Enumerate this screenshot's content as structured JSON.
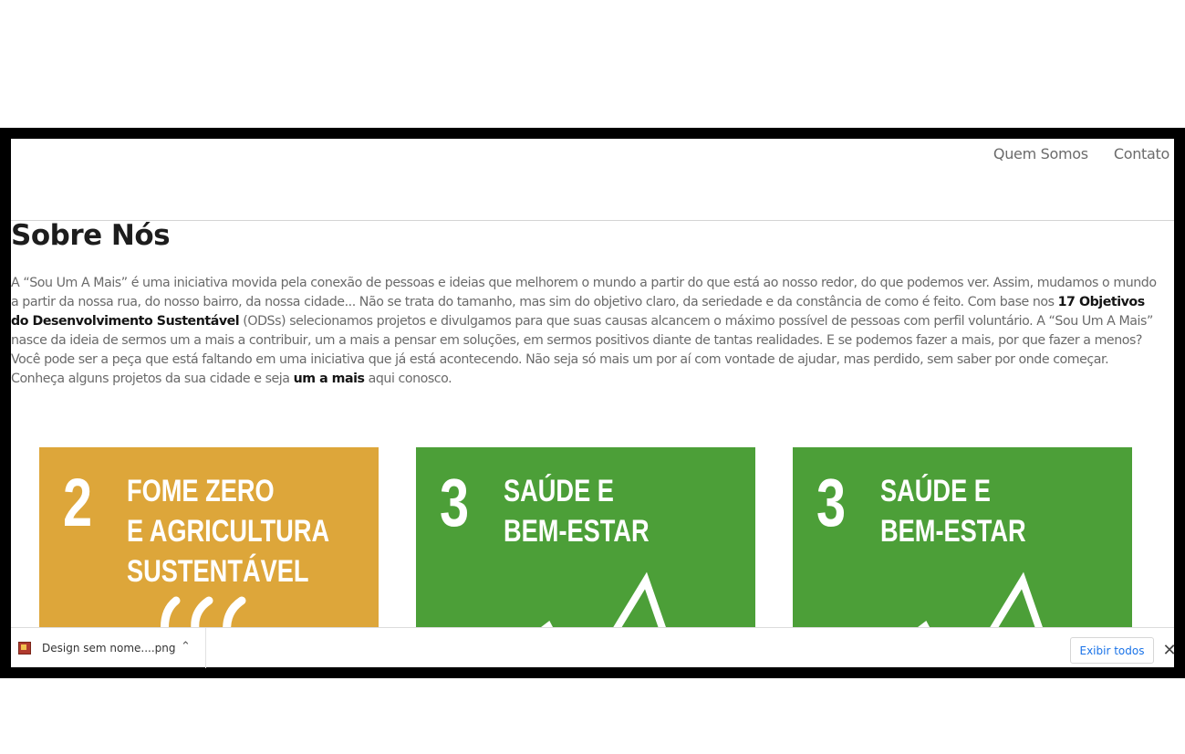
{
  "nav": {
    "items": [
      "Quem Somos",
      "Contato"
    ]
  },
  "section": {
    "title": "Sobre Nós",
    "p1_a": "A “Sou Um A Mais” é uma iniciativa movida pela conexão de pessoas e ideias que melhorem o mundo a partir do que está ao nosso redor, do que podemos ver. Assim, mudamos o mundo a partir da nossa rua, do nosso bairro, da nossa cidade... Não se trata do tamanho, mas sim do objetivo claro, da seriedade e da constância de como é feito. Com base nos ",
    "p1_bold": "17 Objetivos do Desenvolvimento Sustentável",
    "p1_b": " (ODSs) selecionamos projetos e divulgamos para que suas causas alcancem o máximo possível de pessoas com perfil voluntário. A “Sou Um A Mais” nasce da ideia de sermos um a mais a contribuir, um a mais a pensar em soluções, em sermos positivos diante de tantas realidades. E se podemos fazer a mais, por que fazer a menos?",
    "p2_a": "Você pode ser a peça que está faltando em uma iniciativa que já está acontecendo. Não seja só mais um por aí com vontade de ajudar, mas perdido, sem saber por onde começar. Conheça alguns projetos da sua cidade e seja ",
    "p2_bold": "um a mais",
    "p2_b": " aqui conosco."
  },
  "cards": [
    {
      "number": "2",
      "line1": "FOME ZERO",
      "line2": "E AGRICULTURA",
      "line3": "SUSTENTÁVEL",
      "color": "#dda63a",
      "icon": "bowl-icon"
    },
    {
      "number": "3",
      "line1": "SAÚDE E",
      "line2": "BEM-ESTAR",
      "line3": "",
      "color": "#4c9f38",
      "icon": "heartbeat-icon"
    },
    {
      "number": "3",
      "line1": "SAÚDE E",
      "line2": "BEM-ESTAR",
      "line3": "",
      "color": "#4c9f38",
      "icon": "heartbeat-icon"
    }
  ],
  "download_bar": {
    "file_name": "Design sem nome....png",
    "show_all": "Exibir todos",
    "icon": "image-file-icon"
  }
}
